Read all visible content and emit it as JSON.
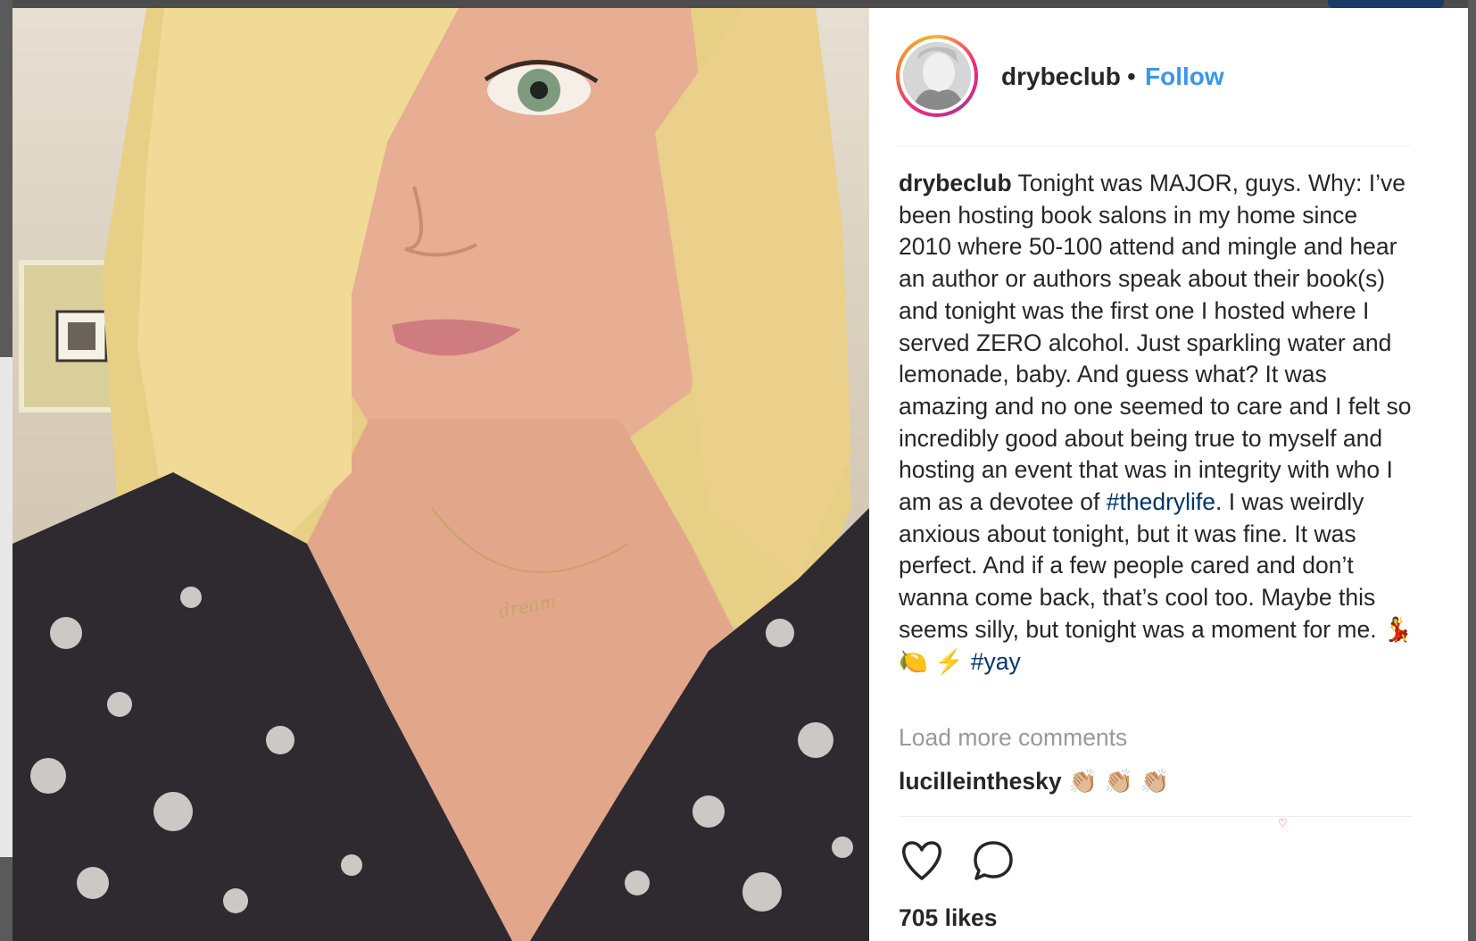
{
  "post": {
    "username": "drybeclub",
    "separator": "•",
    "follow_label": "Follow",
    "caption_user": "drybeclub",
    "caption_part1": " Tonight was MAJOR, guys. Why: I’ve been hosting book salons in my home since 2010 where 50-100 attend and mingle and hear an author or authors speak about their book(s) and tonight was the first one I hosted where I served ZERO alcohol. Just sparkling water and lemonade, baby. And guess what? It was amazing and no one seemed to care and I felt so incredibly good about being true to myself and hosting an event that was in integrity with who I am as a devotee of ",
    "hashtag1": "#thedrylife",
    "caption_part2": ". I was weirdly anxious about tonight, but it was fine. It was perfect. And if a few people cared and don’t wanna come back, that’s cool too. Maybe this seems silly, but tonight was a moment for me. 💃 🍋 ⚡ ",
    "hashtag2": "#yay",
    "load_more_label": "Load more comments",
    "comment_user": "lucilleinthesky",
    "comment_text": " 👏🏼 👏🏼 👏🏼",
    "likes_text": "705 likes",
    "necklace_text": "dream"
  },
  "icons": {
    "like": "heart-icon",
    "comment": "comment-bubble-icon"
  },
  "colors": {
    "follow_blue": "#3897f0",
    "hashtag": "#003569",
    "muted": "#999999",
    "text": "#262626"
  }
}
